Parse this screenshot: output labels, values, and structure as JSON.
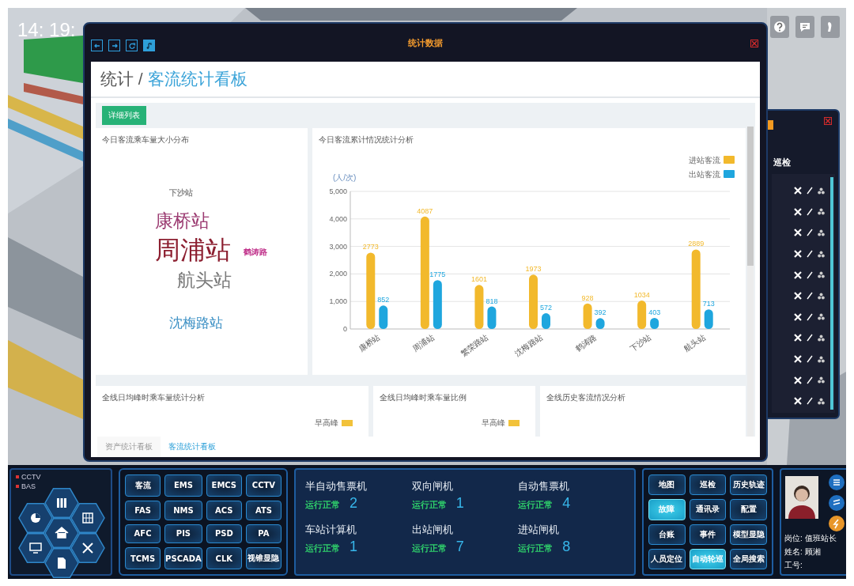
{
  "clock": "14: 19:",
  "modal": {
    "title": "统计数据",
    "breadcrumb": {
      "parent": "统计 /",
      "current": "客流统计看板"
    },
    "detail_button": "详细列表",
    "word_cloud": {
      "title": "今日客流乘车量大小分布",
      "words": [
        {
          "text": "下沙站",
          "kind": "xsmall",
          "color": "#8a8a8a"
        },
        {
          "text": "康桥站",
          "kind": "large",
          "color": "#9c3c72"
        },
        {
          "text": "周浦站",
          "kind": "xlarge",
          "color": "#8c1f30"
        },
        {
          "text": "鹤涛路",
          "kind": "xsmall",
          "color": "#c0308a"
        },
        {
          "text": "航头站",
          "kind": "large",
          "color": "#7a7a7a"
        },
        {
          "text": "沈梅路站",
          "kind": "medium",
          "color": "#3a8fc4"
        }
      ]
    },
    "chart_panel": {
      "title": "今日客流累计情况统计分析",
      "chart_data": {
        "type": "bar",
        "ylabel": "(人/次)",
        "categories": [
          "康桥站",
          "周浦站",
          "繁荣路站",
          "沈梅路站",
          "鹤涛路",
          "下沙站",
          "航头站"
        ],
        "series": [
          {
            "name": "进站客流",
            "color": "#f2b92c",
            "values": [
              2773,
              4087,
              1601,
              1973,
              928,
              1034,
              2889
            ]
          },
          {
            "name": "出站客流",
            "color": "#1fa6de",
            "values": [
              852,
              1775,
              818,
              572,
              392,
              403,
              713
            ]
          }
        ],
        "legend": "top-right",
        "grid": true,
        "ylim": [
          0,
          5000
        ],
        "yticks": [
          {
            "value": 0,
            "label": "0"
          },
          {
            "value": 1000,
            "label": "1,000"
          },
          {
            "value": 2000,
            "label": "2,000"
          },
          {
            "value": 3000,
            "label": "3,000"
          },
          {
            "value": 4000,
            "label": "4,000"
          },
          {
            "value": 5000,
            "label": "5,000"
          }
        ],
        "data_labels": true
      }
    },
    "lower_panels": [
      {
        "title": "全线日均峰时乘车量统计分析",
        "legend": "早高峰"
      },
      {
        "title": "全线日均峰时乘车量比例",
        "legend": "早高峰"
      },
      {
        "title": "全线历史客流情况分析"
      }
    ],
    "tabs": [
      {
        "label": "资产统计看板",
        "selected": false
      },
      {
        "label": "客流统计看板",
        "selected": true
      }
    ]
  },
  "side_panel": {
    "heading": "巡检",
    "rows": [
      {
        "kind": "actions"
      },
      {
        "kind": "actions"
      },
      {
        "kind": "actions"
      },
      {
        "kind": "actions"
      },
      {
        "kind": "actions"
      },
      {
        "kind": "actions"
      },
      {
        "kind": "actions"
      },
      {
        "kind": "actions"
      },
      {
        "kind": "actions"
      },
      {
        "kind": "actions"
      },
      {
        "kind": "actions"
      }
    ]
  },
  "camera_legend": [
    "CCTV",
    "BAS"
  ],
  "system_buttons": [
    "客流",
    "EMS",
    "EMCS",
    "CCTV",
    "FAS",
    "NMS",
    "ACS",
    "ATS",
    "AFC",
    "PIS",
    "PSD",
    "PA",
    "TCMS",
    "PSCADA",
    "CLK",
    "视锥显隐"
  ],
  "devices": [
    {
      "name": "半自动售票机",
      "status": "运行正常",
      "count": "2"
    },
    {
      "name": "双向闸机",
      "status": "运行正常",
      "count": "1"
    },
    {
      "name": "自动售票机",
      "status": "运行正常",
      "count": "4"
    },
    {
      "name": "车站计算机",
      "status": "运行正常",
      "count": "1"
    },
    {
      "name": "出站闸机",
      "status": "运行正常",
      "count": "7"
    },
    {
      "name": "进站闸机",
      "status": "运行正常",
      "count": "8"
    }
  ],
  "nav_buttons": [
    {
      "label": "地图",
      "selected": false
    },
    {
      "label": "巡检",
      "selected": false
    },
    {
      "label": "历史轨迹",
      "selected": false
    },
    {
      "label": "故障",
      "selected": true
    },
    {
      "label": "通讯录",
      "selected": false
    },
    {
      "label": "配置",
      "selected": false
    },
    {
      "label": "台账",
      "selected": false
    },
    {
      "label": "事件",
      "selected": false
    },
    {
      "label": "模型显隐",
      "selected": false
    },
    {
      "label": "人员定位",
      "selected": false
    },
    {
      "label": "自动轮巡",
      "selected": true
    },
    {
      "label": "全局搜索",
      "selected": false
    }
  ],
  "profile": {
    "post": "岗位: 值班站长",
    "name": "姓名: 顾湘",
    "staff_id": "工号:"
  }
}
